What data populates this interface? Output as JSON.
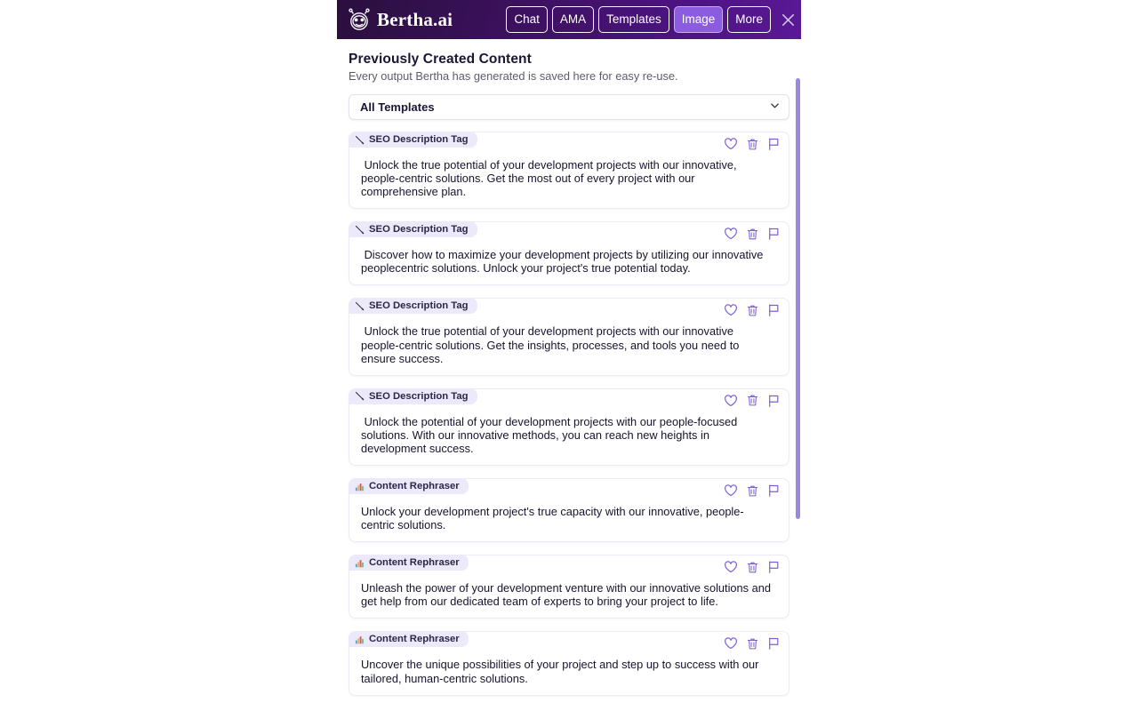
{
  "header": {
    "brand_name": "Bertha.ai",
    "logo_icon": "robot-face-icon",
    "nav": [
      {
        "label": "Chat",
        "active": false
      },
      {
        "label": "AMA",
        "active": false
      },
      {
        "label": "Templates",
        "active": false
      },
      {
        "label": "Image",
        "active": true
      },
      {
        "label": "More",
        "active": false
      }
    ],
    "close_icon": "close-icon",
    "bg_color": "#3d1160",
    "active_nav_color": "#8b5ce0"
  },
  "main": {
    "title": "Previously Created Content",
    "subtitle": "Every output Bertha has generated is saved here for easy re-use.",
    "filter": {
      "value": "All Templates",
      "caret_icon": "chevron-down-icon"
    },
    "actions": {
      "favorite_icon": "heart-icon",
      "delete_icon": "trash-icon",
      "flag_icon": "flag-icon",
      "icon_color": "#7c5fd3"
    },
    "cards": [
      {
        "tag": "SEO Description Tag",
        "tag_icon": "pencil-icon",
        "text": " Unlock the true potential of your development projects with our innovative, people-centric solutions. Get the most out of every project with our comprehensive plan."
      },
      {
        "tag": "SEO Description Tag",
        "tag_icon": "pencil-icon",
        "text": " Discover how to maximize your development projects by utilizing our innovative peoplecentric solutions. Unlock your project's true potential today."
      },
      {
        "tag": "SEO Description Tag",
        "tag_icon": "pencil-icon",
        "text": " Unlock the true potential of your development projects with our innovative people-centric solutions. Get the insights, processes, and tools you need to ensure success."
      },
      {
        "tag": "SEO Description Tag",
        "tag_icon": "pencil-icon",
        "text": " Unlock the potential of your development projects with our people-focused solutions. With our innovative methods, you can reach new heights in development success."
      },
      {
        "tag": "Content Rephraser",
        "tag_icon": "bar-chart-icon",
        "text": "Unlock your development project's true capacity with our innovative, people-centric solutions."
      },
      {
        "tag": "Content Rephraser",
        "tag_icon": "bar-chart-icon",
        "text": "Unleash the power of your development venture with our innovative solutions and get help from our dedicated team of experts to bring your project to life."
      },
      {
        "tag": "Content Rephraser",
        "tag_icon": "bar-chart-icon",
        "text": "Uncover the unique possibilities of your project and step up to success with our tailored, human-centric solutions."
      }
    ]
  },
  "scrollbar": {
    "thumb_color": "#9b87dd"
  }
}
